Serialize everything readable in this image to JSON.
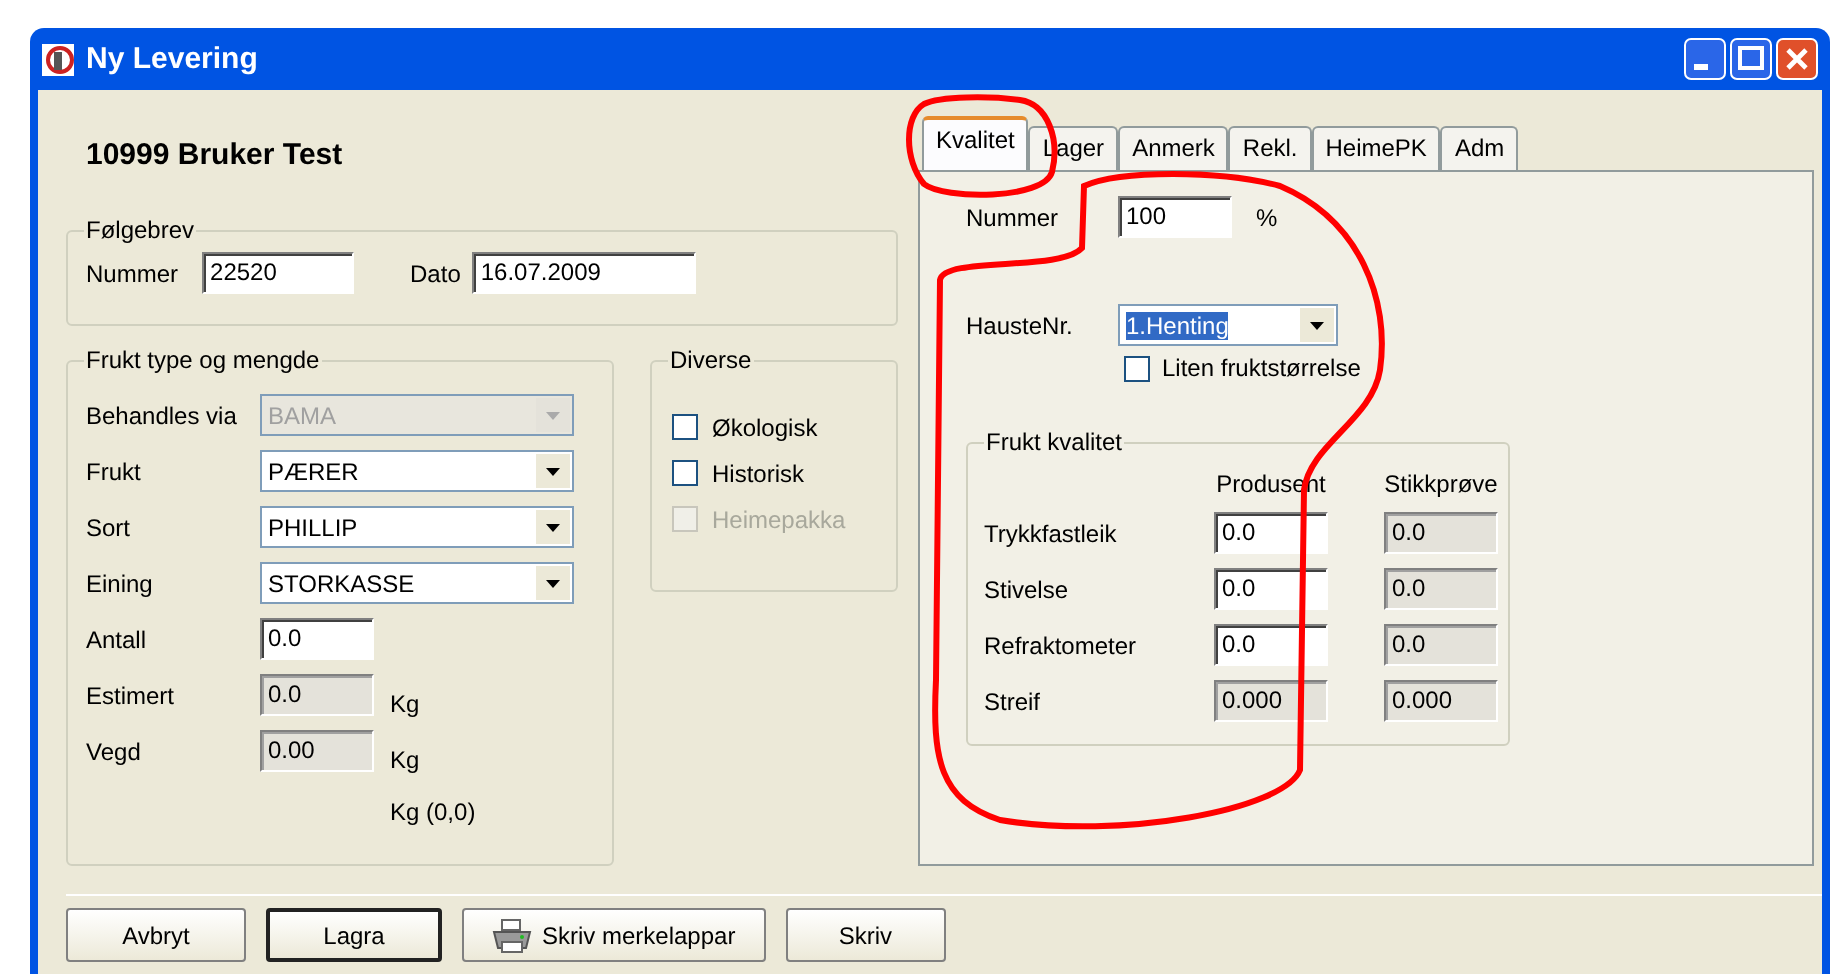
{
  "window": {
    "title": "Ny Levering"
  },
  "header": "10999 Bruker Test",
  "folgebrev": {
    "legend": "Følgebrev",
    "fields": [
      {
        "label": "Nummer",
        "value": "22520"
      },
      {
        "label": "Dato",
        "value": "16.07.2009"
      }
    ]
  },
  "frukt": {
    "legend": "Frukt type og mengde",
    "rows": [
      {
        "kind": "combo",
        "label": "Behandles via",
        "value": "BAMA",
        "disabled": true
      },
      {
        "kind": "combo",
        "label": "Frukt",
        "value": "PÆRER",
        "disabled": false
      },
      {
        "kind": "combo",
        "label": "Sort",
        "value": "PHILLIP",
        "disabled": false
      },
      {
        "kind": "combo",
        "label": "Eining",
        "value": "STORKASSE",
        "disabled": false
      },
      {
        "kind": "input",
        "label": "Antall",
        "value": "0.0",
        "disabled": false
      },
      {
        "kind": "input",
        "label": "Estimert",
        "value": "0.0",
        "disabled": true,
        "unit": "Kg"
      },
      {
        "kind": "input",
        "label": "Vegd",
        "value": "0.00",
        "disabled": true,
        "unit": "Kg"
      }
    ],
    "footer": "Kg (0,0)"
  },
  "diverse": {
    "legend": "Diverse",
    "items": [
      {
        "label": "Økologisk",
        "checked": false,
        "disabled": false
      },
      {
        "label": "Historisk",
        "checked": false,
        "disabled": false
      },
      {
        "label": "Heimepakka",
        "checked": false,
        "disabled": true
      }
    ]
  },
  "tabs": [
    {
      "label": "Kvalitet",
      "selected": true
    },
    {
      "label": "Lager",
      "selected": false
    },
    {
      "label": "Anmerk",
      "selected": false
    },
    {
      "label": "Rekl.",
      "selected": false
    },
    {
      "label": "HeimePK",
      "selected": false
    },
    {
      "label": "Adm",
      "selected": false
    }
  ],
  "kvalitet": {
    "nummer": {
      "label": "Nummer",
      "value": "100",
      "unit": "%"
    },
    "hauste": {
      "label": "HausteNr.",
      "value": "1.Henting",
      "text_selected": true
    },
    "liten": {
      "label": "Liten fruktstørrelse",
      "checked": false
    },
    "group": {
      "legend": "Frukt kvalitet",
      "columns": [
        "Produsent",
        "Stikkprøve"
      ],
      "rows": [
        {
          "label": "Trykkfastleik",
          "cells": [
            {
              "value": "0.0",
              "disabled": false
            },
            {
              "value": "0.0",
              "disabled": true
            }
          ]
        },
        {
          "label": "Stivelse",
          "cells": [
            {
              "value": "0.0",
              "disabled": false
            },
            {
              "value": "0.0",
              "disabled": true
            }
          ]
        },
        {
          "label": "Refraktometer",
          "cells": [
            {
              "value": "0.0",
              "disabled": false
            },
            {
              "value": "0.0",
              "disabled": true
            }
          ]
        },
        {
          "label": "Streif",
          "cells": [
            {
              "value": "0.000",
              "disabled": true
            },
            {
              "value": "0.000",
              "disabled": true
            }
          ]
        }
      ]
    }
  },
  "buttons": [
    {
      "kind": "plain",
      "label": "Avbryt",
      "default": false
    },
    {
      "kind": "plain",
      "label": "Lagra",
      "default": true
    },
    {
      "kind": "print",
      "label": "Skriv merkelappar",
      "default": false
    },
    {
      "kind": "plain",
      "label": "Skriv",
      "default": false
    }
  ]
}
